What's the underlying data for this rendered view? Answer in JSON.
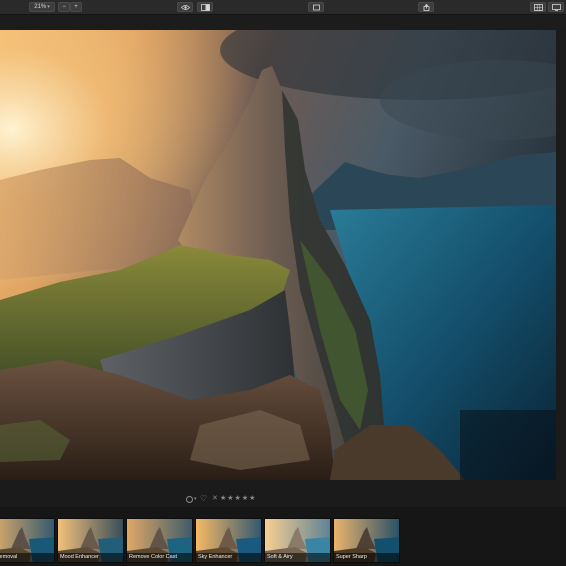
{
  "toolbar": {
    "zoom_value": "21%",
    "zoom_caret": "▾",
    "zoom_out": "−",
    "zoom_in": "+"
  },
  "icons": {
    "eye": "eye-icon",
    "compare": "compare-icon",
    "crop": "crop-icon",
    "share": "share-icon",
    "grid": "grid-view-icon",
    "monitor": "monitor-icon"
  },
  "rating": {
    "circle_caret": "▾",
    "heart": "♡",
    "reject": "✕",
    "stars": "★★★★★",
    "star_count": 0
  },
  "filmstrip": {
    "presets": [
      {
        "label": "...Removal"
      },
      {
        "label": "Mood Enhancer"
      },
      {
        "label": "Remove Color Cast"
      },
      {
        "label": "Sky Enhancer"
      },
      {
        "label": "Soft & Airy"
      },
      {
        "label": "Super Sharp"
      }
    ]
  }
}
